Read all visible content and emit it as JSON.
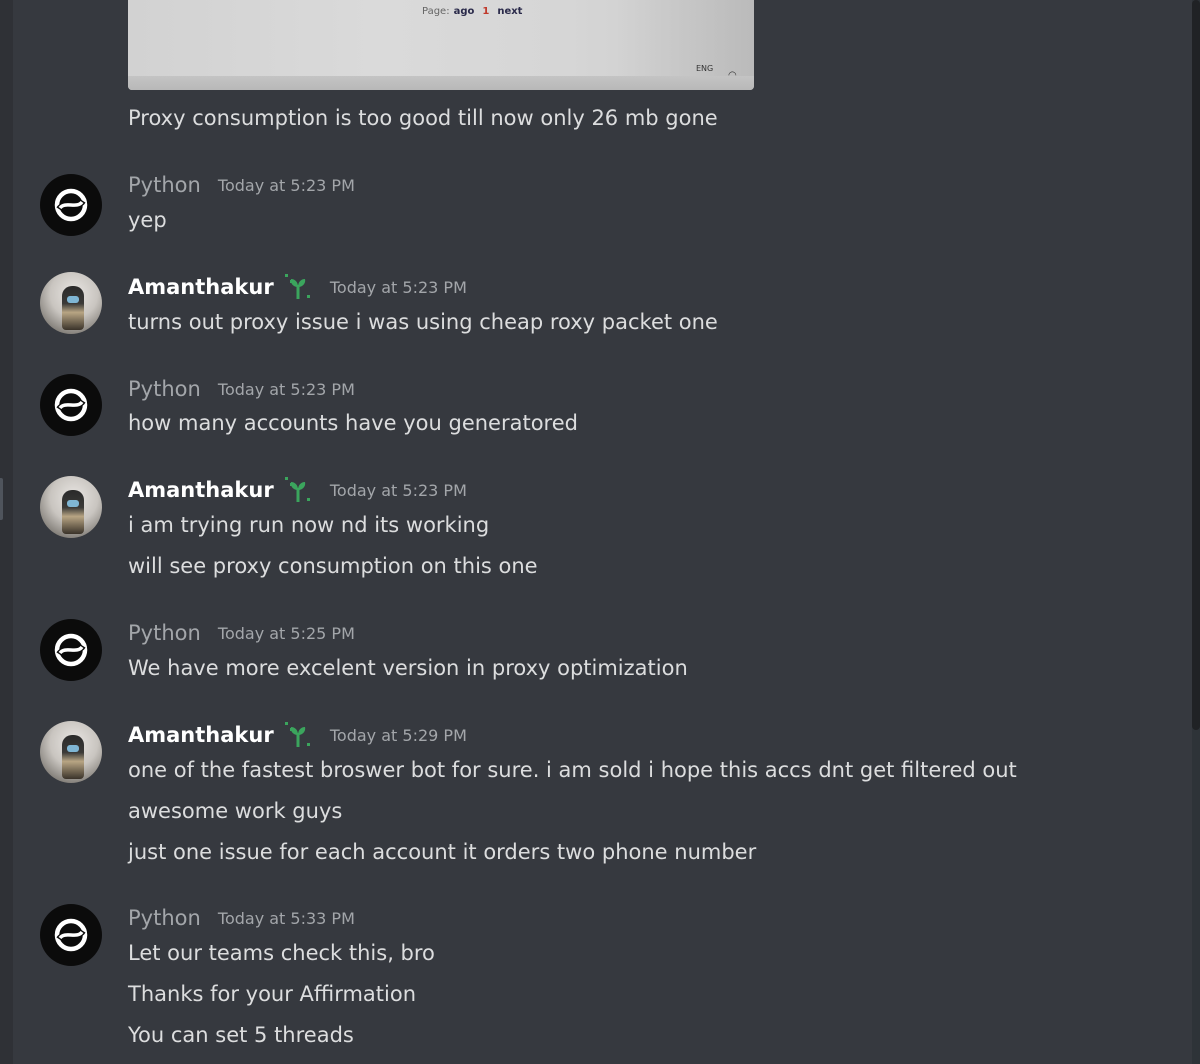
{
  "attachment": {
    "pager_label": "Page:",
    "pager_prev": "ago",
    "pager_current": "1",
    "pager_next": "next",
    "tray_lang": "ENG"
  },
  "messages": [
    {
      "author": "",
      "timestamp": "",
      "lines": [
        "Proxy consumption is too good till now only 26 mb gone"
      ]
    },
    {
      "author": "Python",
      "timestamp": "Today at 5:23 PM",
      "lines": [
        "yep"
      ]
    },
    {
      "author": "Amanthakur",
      "timestamp": "Today at 5:23 PM",
      "lines": [
        "turns out proxy issue i was using cheap roxy packet one"
      ]
    },
    {
      "author": "Python",
      "timestamp": "Today at 5:23 PM",
      "lines": [
        "how many accounts have you generatored"
      ]
    },
    {
      "author": "Amanthakur",
      "timestamp": "Today at 5:23 PM",
      "lines": [
        "i am trying run now nd its working",
        "will see proxy consumption on this one"
      ]
    },
    {
      "author": "Python",
      "timestamp": "Today at 5:25 PM",
      "lines": [
        "We have more excelent version in proxy optimization"
      ]
    },
    {
      "author": "Amanthakur",
      "timestamp": "Today at 5:29 PM",
      "lines": [
        "one of the fastest broswer bot for sure. i am sold i hope this accs dnt get filtered out",
        "awesome work guys",
        "just one issue for each account it orders two phone number"
      ]
    },
    {
      "author": "Python",
      "timestamp": "Today at 5:33 PM",
      "lines": [
        "Let our teams check this, bro",
        "Thanks for your Affirmation",
        "You can set 5 threads"
      ]
    }
  ],
  "colors": {
    "background": "#36393f",
    "text": "#dcddde",
    "timestamp": "#a3a6aa",
    "badge": "#3ba55d"
  },
  "icons": {
    "python_avatar": "python-logo-icon",
    "badge": "early-supporter-sprout-icon"
  }
}
